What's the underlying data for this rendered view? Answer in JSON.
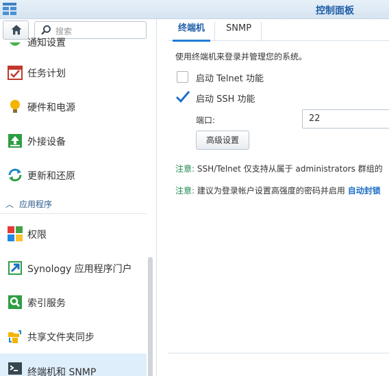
{
  "window": {
    "title": "控制面板"
  },
  "search": {
    "placeholder": "搜索"
  },
  "sidebar": {
    "partial_item_label": "通知设置",
    "items": [
      {
        "label": "任务计划",
        "icon": "calendar-check-icon"
      },
      {
        "label": "硬件和电源",
        "icon": "lightbulb-icon"
      },
      {
        "label": "外接设备",
        "icon": "upload-arrow-icon"
      },
      {
        "label": "更新和还原",
        "icon": "refresh-icon"
      }
    ],
    "group_label": "应用程序",
    "app_items": [
      {
        "label": "权限",
        "icon": "permission-grid-icon"
      },
      {
        "label": "Synology 应用程序门户",
        "icon": "portal-arrow-icon"
      },
      {
        "label": "索引服务",
        "icon": "index-search-icon"
      },
      {
        "label": "共享文件夹同步",
        "icon": "folder-sync-icon"
      },
      {
        "label": "终端机和 SNMP",
        "icon": "terminal-icon"
      }
    ]
  },
  "tabs": [
    {
      "label": "终端机"
    },
    {
      "label": "SNMP"
    }
  ],
  "terminal": {
    "description": "使用终端机来登录并管理您的系统。",
    "telnet_label": "启动 Telnet 功能",
    "telnet_checked": false,
    "ssh_label": "启动 SSH 功能",
    "ssh_checked": true,
    "port_label": "端口:",
    "port_value": "22",
    "advanced_button": "高级设置"
  },
  "notes": [
    {
      "label": "注意:",
      "text": "SSH/Telnet 仅支持从属于 administrators 群组的"
    },
    {
      "label": "注意:",
      "text": "建议为登录帐户设置高强度的密码并启用 ",
      "link": "自动封锁"
    }
  ],
  "colors": {
    "accent": "#1f5fa8",
    "note_green": "#1d8a4e",
    "active_bg": "#dfeefb"
  }
}
